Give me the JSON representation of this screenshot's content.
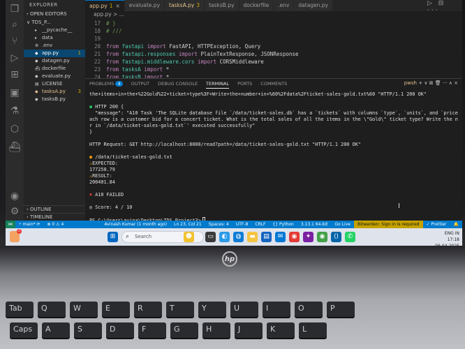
{
  "sidebar": {
    "title": "EXPLORER",
    "open_editors": "OPEN EDITORS",
    "folder": "TDS_P...",
    "files": [
      {
        "name": "__pycache__",
        "icon": "folder",
        "badge": ""
      },
      {
        "name": "data",
        "icon": "folder",
        "badge": ""
      },
      {
        "name": ".env",
        "icon": "gear",
        "badge": ""
      },
      {
        "name": "app.py",
        "icon": "python",
        "badge": "1"
      },
      {
        "name": "datagen.py",
        "icon": "python",
        "badge": ""
      },
      {
        "name": "dockerfile",
        "icon": "docker",
        "badge": ""
      },
      {
        "name": "evaluate.py",
        "icon": "python",
        "badge": ""
      },
      {
        "name": "LICENSE",
        "icon": "license",
        "badge": ""
      },
      {
        "name": "tasksA.py",
        "icon": "python",
        "badge": "3"
      },
      {
        "name": "tasksB.py",
        "icon": "python",
        "badge": ""
      }
    ],
    "outline": "OUTLINE",
    "timeline": "TIMELINE"
  },
  "tabs": [
    {
      "label": "app.py",
      "badge": "1",
      "close": "×"
    },
    {
      "label": "evaluate.py",
      "badge": ""
    },
    {
      "label": "tasksA.py",
      "badge": "3"
    },
    {
      "label": "tasksB.py",
      "badge": ""
    },
    {
      "label": "dockerfile",
      "badge": ""
    },
    {
      "label": ".env",
      "badge": ""
    },
    {
      "label": "datagen.py",
      "badge": ""
    }
  ],
  "breadcrumb": "app.py > ...",
  "code_lines": [
    {
      "num": "17",
      "text": "# }"
    },
    {
      "num": "18",
      "text": "# ///"
    },
    {
      "num": "19",
      "text": ""
    },
    {
      "num": "20",
      "kw1": "from",
      "mod": "fastapi",
      "kw2": "import",
      "rest": "FastAPI, HTTPException, Query"
    },
    {
      "num": "21",
      "kw1": "from",
      "mod": "fastapi.responses",
      "kw2": "import",
      "rest": "PlainTextResponse, JSONResponse"
    },
    {
      "num": "22",
      "kw1": "from",
      "mod": "fastapi.middleware.cors",
      "kw2": "import",
      "rest": "CORSMiddleware"
    },
    {
      "num": "23",
      "kw1": "from",
      "mod": "tasksA",
      "kw2": "import",
      "rest": "*"
    },
    {
      "num": "24",
      "kw1": "from",
      "mod": "tasksB",
      "kw2": "import",
      "rest": "*"
    }
  ],
  "panel": {
    "tabs": [
      "PROBLEMS",
      "OUTPUT",
      "DEBUG CONSOLE",
      "TERMINAL",
      "PORTS",
      "COMMENTS"
    ],
    "problems_count": "4",
    "shell_label": "pwsh",
    "actions": "+ ∨ ⊞ 🗑 ··· ∧ ×"
  },
  "terminal": {
    "url_line": "the+items+in+the+%22Gold%22+ticket+type%3F+Write+the+number+in+%60%2Fdata%2Fticket-sales-gold.txt%60 \"HTTP/1.1 200 OK\"",
    "status": "HTTP 200 {",
    "msg1": "  \"message\": \"A10 Task 'The SQLite database file `/data/ticket-sales.db` has a `tickets` with columns `type`, `units`, and `price`. E",
    "msg2": "ach row is a customer bid for a concert ticket. What is the total sales of all the items in the \\\"Gold\\\" ticket type? Write the numbe",
    "msg3": "r in `/data/ticket-sales-gold.txt`' executed successfully\"",
    "close_brace": "}",
    "request": "HTTP Request: GET http://localhost:8000/read?path=/data/ticket-sales-gold.txt \"HTTP/1.1 200 OK\"",
    "file_path": "/data/ticket-sales-gold.txt",
    "expected_label": "EXPECTED:",
    "expected_value": "177250.79",
    "result_label": "RESULT:",
    "result_value": "200401.84",
    "failed": "A10 FAILED",
    "score": "Score: 4 / 10",
    "prompt": "PS C:\\Users\\avina\\Desktop\\TDS_Project3>"
  },
  "statusbar": {
    "branch": "main*",
    "sync": "⟳",
    "errors": "⊗ 0",
    "warnings": "⚠ 4",
    "author": "Avinash Kumar (1 month ago)",
    "position": "Ln 23, Col 21",
    "spaces": "Spaces: 4",
    "encoding": "UTF-8",
    "eol": "CRLF",
    "language": "{} Python",
    "interpreter": "3.13.1 64-bit",
    "golive": "Go Live",
    "sign_in": "Bitwarden: Sign in is required",
    "prettier": "✓ Prettier"
  },
  "taskbar": {
    "search_placeholder": "Search",
    "time": "17:18",
    "date": "06-04-2025",
    "lang": "ENG IN",
    "weather_badge": "2"
  },
  "laptop": {
    "logo": "hp",
    "keys_row1": [
      "Tab",
      "Q",
      "W",
      "E",
      "R",
      "T",
      "Y",
      "U",
      "I",
      "O",
      "P"
    ],
    "keys_row2": [
      "Caps",
      "A",
      "S",
      "D",
      "F",
      "G",
      "H",
      "J",
      "K",
      "L"
    ]
  },
  "colors": {
    "statusbar": "#007acc",
    "success": "#22c55e",
    "failure": "#ef4444",
    "warning": "#f59e0b"
  }
}
